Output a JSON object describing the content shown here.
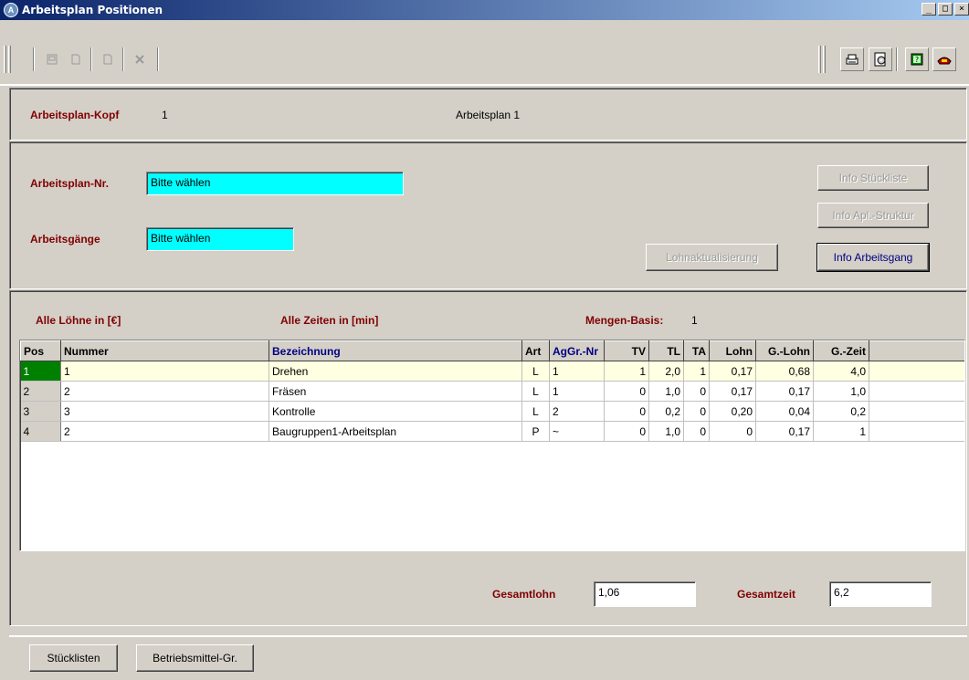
{
  "window": {
    "title": "Arbeitsplan Positionen",
    "icon": "app-icon",
    "minimize": "_",
    "maximize": "□",
    "close": "×"
  },
  "toolbar": {
    "left_icons": [
      "edit-icon",
      "new-icon",
      "copy-icon",
      "delete-icon"
    ],
    "right_icons": [
      "print-icon",
      "settings-icon",
      "help-icon",
      "exit-icon"
    ]
  },
  "header": {
    "label": "Arbeitsplan-Kopf",
    "number": "1",
    "name": "Arbeitsplan 1"
  },
  "selection": {
    "plan_label": "Arbeitsplan-Nr.",
    "plan_value": "Bitte wählen",
    "ops_label": "Arbeitsgänge",
    "ops_value": "Bitte wählen"
  },
  "buttons": {
    "info_stueckliste": "Info Stückliste",
    "info_apl_struktur": "Info Apl.-Struktur",
    "lohnaktualisierung": "Lohnaktualisierung",
    "info_arbeitsgang": "Info Arbeitsgang"
  },
  "info": {
    "loehne": "Alle Löhne in [€]",
    "zeiten": "Alle Zeiten in [min]",
    "mengen_label": "Mengen-Basis:",
    "mengen_value": "1"
  },
  "table": {
    "columns": [
      "Pos",
      "Nummer",
      "Bezeichnung",
      "Art",
      "AgGr.-Nr",
      "TV",
      "TL",
      "TA",
      "Lohn",
      "G.-Lohn",
      "G.-Zeit"
    ],
    "rows": [
      [
        "1",
        "1",
        "Drehen",
        "L",
        "1",
        "1",
        "2,0",
        "1",
        "0,17",
        "0,68",
        "4,0"
      ],
      [
        "2",
        "2",
        "Fräsen",
        "L",
        "1",
        "0",
        "1,0",
        "0",
        "0,17",
        "0,17",
        "1,0"
      ],
      [
        "3",
        "3",
        "Kontrolle",
        "L",
        "2",
        "0",
        "0,2",
        "0",
        "0,20",
        "0,04",
        "0,2"
      ],
      [
        "4",
        "2",
        "Baugruppen1-Arbeitsplan",
        "P",
        "~",
        "0",
        "1,0",
        "0",
        "0",
        "0,17",
        "1"
      ]
    ]
  },
  "totals": {
    "lohn_label": "Gesamtlohn",
    "lohn_value": "1,06",
    "zeit_label": "Gesamtzeit",
    "zeit_value": "6,2"
  },
  "footer": {
    "stuecklisten": "Stücklisten",
    "betriebsmittel": "Betriebsmittel-Gr."
  },
  "colors": {
    "label_red": "#800000",
    "input_cyan": "#00ffff",
    "selected_row": "#ffffe1",
    "selected_pos": "#008000"
  }
}
